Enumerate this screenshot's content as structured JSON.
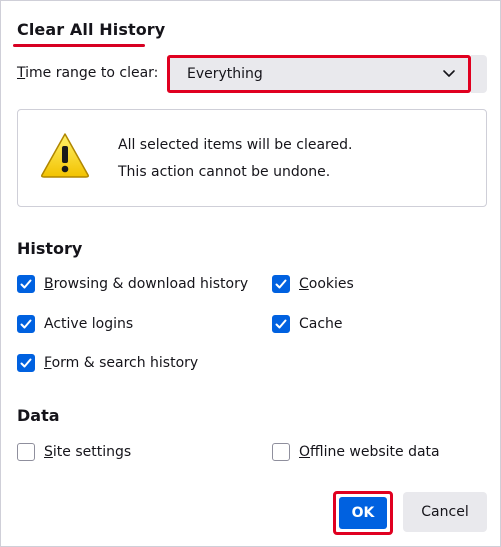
{
  "dialog": {
    "title": "Clear All History"
  },
  "time_range": {
    "label_u": "T",
    "label_rest": "ime range to clear:",
    "selected": "Everything"
  },
  "warning": {
    "line1": "All selected items will be cleared.",
    "line2": "This action cannot be undone."
  },
  "history": {
    "heading": "History",
    "items": [
      {
        "label_u": "B",
        "label_rest": "rowsing & download history",
        "checked": true
      },
      {
        "label_u": "C",
        "label_rest": "ookies",
        "checked": true
      },
      {
        "label_u": "",
        "label_rest": "Active logins",
        "checked": true
      },
      {
        "label_u": "",
        "label_rest": "Cache",
        "checked": true
      },
      {
        "label_u": "F",
        "label_rest": "orm & search history",
        "checked": true
      }
    ]
  },
  "data_section": {
    "heading": "Data",
    "items": [
      {
        "label_u": "S",
        "label_rest": "ite settings",
        "checked": false
      },
      {
        "label_u": "O",
        "label_rest": "ffline website data",
        "checked": false
      }
    ]
  },
  "buttons": {
    "ok": "OK",
    "cancel": "Cancel"
  },
  "colors": {
    "accent": "#0061e0",
    "highlight": "#e00020"
  }
}
